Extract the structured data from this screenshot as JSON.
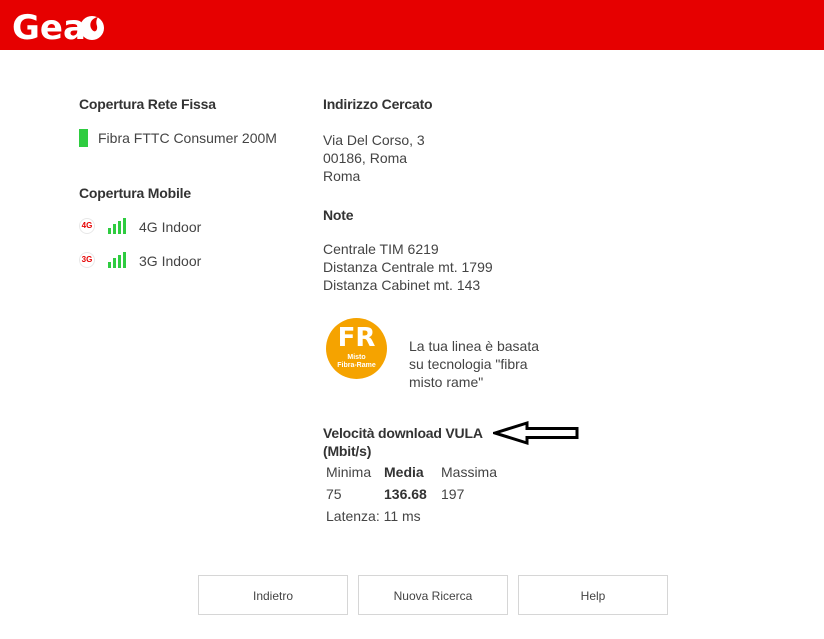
{
  "header": {
    "logo_text": "Gea",
    "brand_color": "#e60000",
    "logo_icon": "vodafone-speech-mark-icon"
  },
  "fixed": {
    "title": "Copertura Rete Fissa",
    "item": "Fibra FTTC Consumer 200M",
    "indicator_color": "#2ecc40"
  },
  "mobile": {
    "title": "Copertura Mobile",
    "items": [
      {
        "badge": "4G",
        "label": "4G Indoor",
        "icon": "signal-bars-icon"
      },
      {
        "badge": "3G",
        "label": "3G Indoor",
        "icon": "signal-bars-icon"
      }
    ]
  },
  "address": {
    "title": "Indirizzo Cercato",
    "lines": [
      "Via Del Corso, 3",
      "00186, Roma",
      "Roma"
    ]
  },
  "note": {
    "title": "Note",
    "lines": [
      "Centrale TIM 6219",
      "Distanza Centrale mt. 1799",
      "Distanza Cabinet mt. 143"
    ]
  },
  "technology": {
    "badge_main": "FR",
    "badge_sub1": "Misto",
    "badge_sub2": "Fibra-Rame",
    "badge_color": "#f5a300",
    "desc_lines": [
      "La tua linea è basata",
      "su tecnologia \"fibra",
      "misto rame\""
    ]
  },
  "speed": {
    "title_line1": "Velocità download VULA",
    "title_line2": "(Mbit/s)",
    "headers": {
      "min": "Minima",
      "avg": "Media",
      "max": "Massima"
    },
    "values": {
      "min": "75",
      "avg": "136.68",
      "max": "197"
    },
    "latency": "Latenza: 11 ms",
    "annotation_icon": "arrow-left-icon"
  },
  "buttons": {
    "back": "Indietro",
    "new_search": "Nuova Ricerca",
    "help": "Help"
  }
}
